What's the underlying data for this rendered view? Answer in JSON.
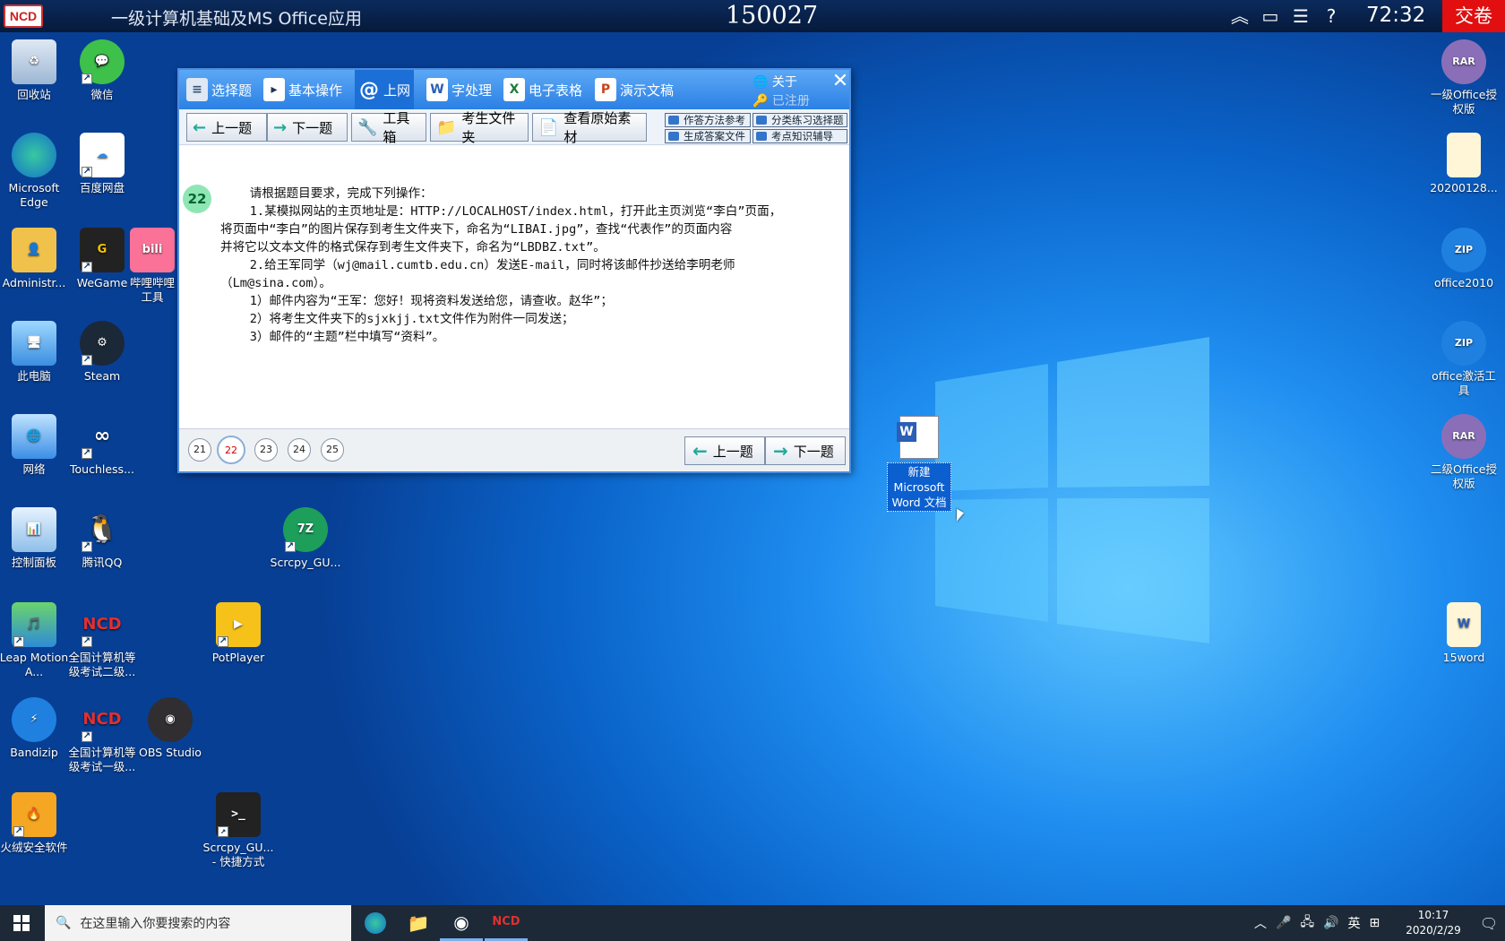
{
  "topbar": {
    "logo": "NCD",
    "title": "一级计算机基础及MS Office应用",
    "exam_id": "150027",
    "timer": "72:32",
    "submit_label": "交卷"
  },
  "desktop_left": [
    {
      "label": "回收站",
      "icon": "recycle-bin-icon"
    },
    {
      "label": "微信",
      "icon": "wechat-icon"
    },
    {
      "label": "Microsoft Edge",
      "icon": "edge-icon"
    },
    {
      "label": "百度网盘",
      "icon": "baidu-netdisk-icon"
    },
    {
      "label": "Administr...",
      "icon": "user-folder-icon"
    },
    {
      "label": "WeGame",
      "icon": "wegame-icon"
    },
    {
      "label": "哔哩哔哩工具",
      "icon": "bilibili-icon"
    },
    {
      "label": "此电脑",
      "icon": "this-pc-icon"
    },
    {
      "label": "Steam",
      "icon": "steam-icon"
    },
    {
      "label": "网络",
      "icon": "network-icon"
    },
    {
      "label": "Touchless...",
      "icon": "touchless-icon"
    },
    {
      "label": "控制面板",
      "icon": "control-panel-icon"
    },
    {
      "label": "腾讯QQ",
      "icon": "qq-icon"
    },
    {
      "label": "Scrcpy_GU...",
      "icon": "7z-icon"
    },
    {
      "label": "Leap Motion A...",
      "icon": "leap-motion-icon"
    },
    {
      "label": "全国计算机等级考试二级...",
      "icon": "ncd-exam-icon"
    },
    {
      "label": "PotPlayer",
      "icon": "potplayer-icon"
    },
    {
      "label": "Bandizip",
      "icon": "bandizip-icon"
    },
    {
      "label": "全国计算机等级考试一级...",
      "icon": "ncd-exam-icon"
    },
    {
      "label": "OBS Studio",
      "icon": "obs-icon"
    },
    {
      "label": "火绒安全软件",
      "icon": "huorong-icon"
    },
    {
      "label": "Scrcpy_GU... - 快捷方式",
      "icon": "terminal-icon"
    }
  ],
  "desktop_right": [
    {
      "label": "一级Office授权版",
      "icon": "rar-icon"
    },
    {
      "label": "20200128...",
      "icon": "document-icon"
    },
    {
      "label": "office2010",
      "icon": "zip-icon"
    },
    {
      "label": "office激活工具",
      "icon": "zip-icon"
    },
    {
      "label": "二级Office授权版",
      "icon": "rar-icon"
    },
    {
      "label": "15word",
      "icon": "word-doc-icon"
    }
  ],
  "selected_file": {
    "label": "新建 Microsoft Word 文档"
  },
  "app": {
    "tabs": [
      {
        "label": "选择题"
      },
      {
        "label": "基本操作"
      },
      {
        "label": "上网"
      },
      {
        "label": "字处理"
      },
      {
        "label": "电子表格"
      },
      {
        "label": "演示文稿"
      }
    ],
    "about": "关于",
    "registered": "已注册",
    "toolbar": {
      "prev": "上一题",
      "next": "下一题",
      "toolbox": "工具箱",
      "exam_folder": "考生文件夹",
      "view_material": "查看原始素材",
      "method_ref": "作答方法参考",
      "practice": "分类练习选择题",
      "gen_answer": "生成答案文件",
      "knowledge": "考点知识辅导"
    },
    "question_number": "22",
    "question_lines": [
      "    请根据题目要求，完成下列操作：",
      "    1.某模拟网站的主页地址是：HTTP://LOCALHOST/index.html，打开此主页浏览“李白”页面，",
      "将页面中“李白”的图片保存到考生文件夹下，命名为“LIBAI.jpg”，查找“代表作”的页面内容",
      "并将它以文本文件的格式保存到考生文件夹下，命名为“LBDBZ.txt”。",
      "    2.给王军同学（wj@mail.cumtb.edu.cn）发送E-mail，同时将该邮件抄送给李明老师",
      "（Lm@sina.com）。",
      "    1）邮件内容为“王军：您好！现将资料发送给您，请查收。赵华”；",
      "    2）将考生文件夹下的sjxkjj.txt文件作为附件一同发送；",
      "    3）邮件的“主题”栏中填写“资料”。"
    ],
    "pages": [
      "21",
      "22",
      "23",
      "24",
      "25"
    ],
    "current_page": "22",
    "bottom_prev": "上一题",
    "bottom_next": "下一题"
  },
  "taskbar": {
    "search_placeholder": "在这里输入你要搜索的内容",
    "ime": "英",
    "time": "10:17",
    "date": "2020/2/29"
  }
}
